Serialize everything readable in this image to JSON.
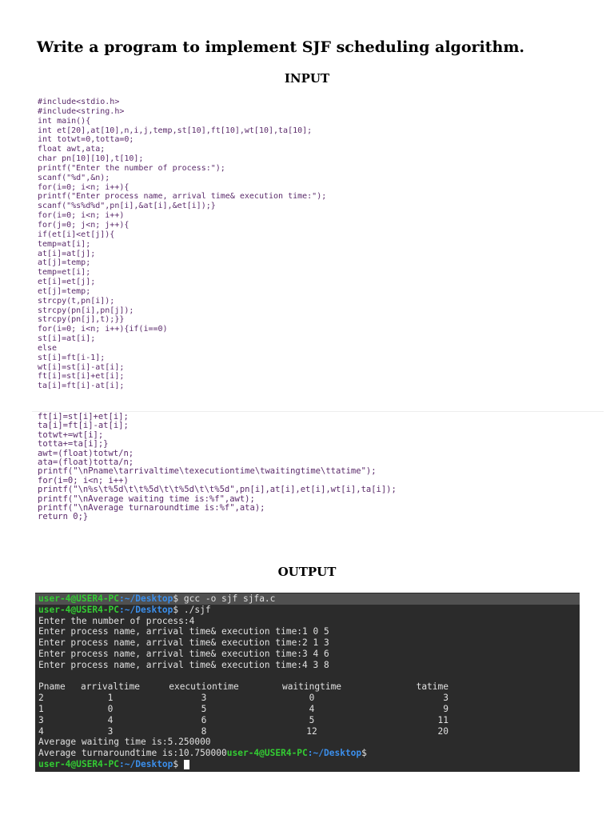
{
  "title": "Write a program to implement SJF scheduling algorithm.",
  "input_heading": "INPUT",
  "output_heading": "OUTPUT",
  "code_part1": [
    "#include<stdio.h>",
    "#include<string.h>",
    "int main(){",
    "int et[20],at[10],n,i,j,temp,st[10],ft[10],wt[10],ta[10];",
    "int totwt=0,totta=0;",
    "float awt,ata;",
    "char pn[10][10],t[10];",
    "printf(\"Enter the number of process:\");",
    "scanf(\"%d\",&n);",
    "for(i=0; i<n; i++){",
    "printf(\"Enter process name, arrival time& execution time:\");",
    "scanf(\"%s%d%d\",pn[i],&at[i],&et[i]);}",
    "for(i=0; i<n; i++)",
    "for(j=0; j<n; j++){",
    "if(et[i]<et[j]){",
    "temp=at[i];",
    "at[i]=at[j];",
    "at[j]=temp;",
    "temp=et[i];",
    "et[i]=et[j];",
    "et[j]=temp;",
    "strcpy(t,pn[i]);",
    "strcpy(pn[i],pn[j]);",
    "strcpy(pn[j],t);}}",
    "for(i=0; i<n; i++){if(i==0)",
    "st[i]=at[i];",
    "else",
    "st[i]=ft[i-1];",
    "wt[i]=st[i]-at[i];",
    "ft[i]=st[i]+et[i];",
    "ta[i]=ft[i]-at[i];"
  ],
  "code_part2": [
    "ft[i]=st[i]+et[i];",
    "ta[i]=ft[i]-at[i];",
    "totwt+=wt[i];",
    "totta+=ta[i];}",
    "awt=(float)totwt/n;",
    "ata=(float)totta/n;",
    "printf(\"\\nPname\\tarrivaltime\\texecutiontime\\twaitingtime\\ttatime\");",
    "for(i=0; i<n; i++)",
    "printf(\"\\n%s\\t%5d\\t\\t%5d\\t\\t%5d\\t\\t%5d\",pn[i],at[i],et[i],wt[i],ta[i]);",
    "printf(\"\\nAverage waiting time is:%f\",awt);",
    "printf(\"\\nAverage turnaroundtime is:%f\",ata);",
    "return 0;}"
  ],
  "terminal": {
    "prompt_user": "user-4@USER4-PC",
    "prompt_path": ":~/Desktop",
    "prompt_sign": "$",
    "cmd1": " gcc -o sjf sjfa.c",
    "cmd2": " ./sjf",
    "lines": [
      "Enter the number of process:4",
      "Enter process name, arrival time& execution time:1 0 5",
      "Enter process name, arrival time& execution time:2 1 3",
      "Enter process name, arrival time& execution time:3 4 6",
      "Enter process name, arrival time& execution time:4 3 8"
    ],
    "table_headers": [
      "Pname",
      "arrivaltime",
      "executiontime",
      "waitingtime",
      "tatime"
    ],
    "table_rows": [
      [
        "2",
        "1",
        "3",
        "0",
        "3"
      ],
      [
        "1",
        "0",
        "5",
        "4",
        "9"
      ],
      [
        "3",
        "4",
        "6",
        "5",
        "11"
      ],
      [
        "4",
        "3",
        "8",
        "12",
        "20"
      ]
    ],
    "avg_wait": "Average waiting time is:5.250000",
    "avg_ta": "Average turnaroundtime is:10.750000"
  }
}
